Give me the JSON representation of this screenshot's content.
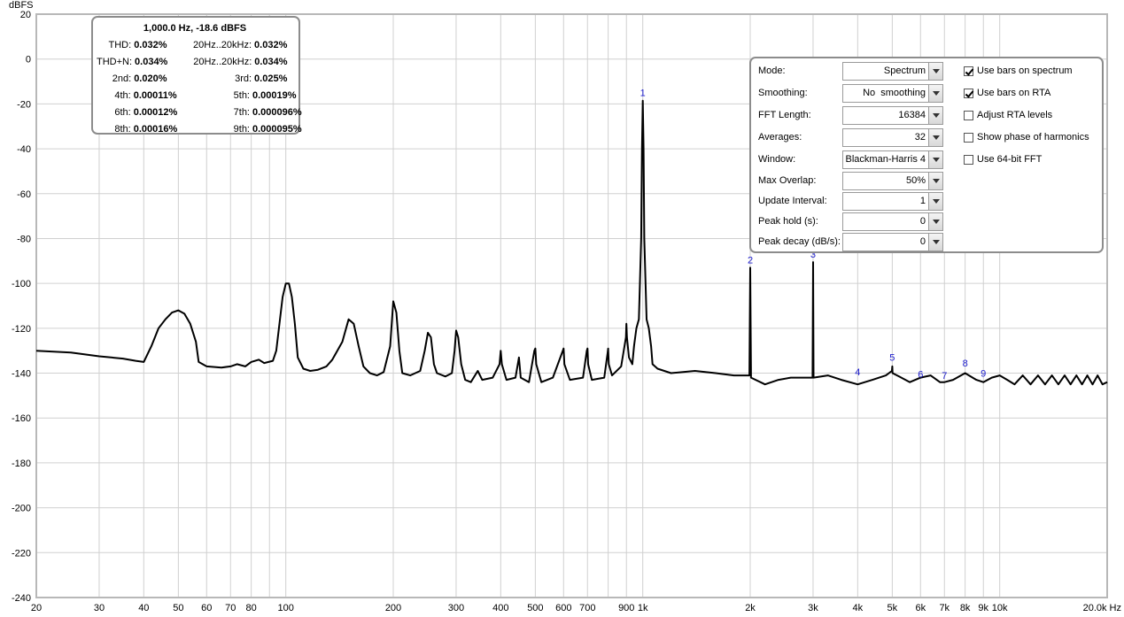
{
  "chart_data": {
    "type": "line",
    "title": "",
    "xlabel": "Hz",
    "ylabel": "dBFS",
    "x_scale": "log",
    "xlim": [
      20,
      20000
    ],
    "ylim": [
      -240,
      20
    ],
    "grid": true,
    "y_ticks": [
      20,
      0,
      -20,
      -40,
      -60,
      -80,
      -100,
      -120,
      -140,
      -160,
      -180,
      -200,
      -220,
      -240
    ],
    "x_ticks": [
      {
        "value": 20,
        "label": "20"
      },
      {
        "value": 30,
        "label": "30"
      },
      {
        "value": 40,
        "label": "40"
      },
      {
        "value": 50,
        "label": "50"
      },
      {
        "value": 60,
        "label": "60"
      },
      {
        "value": 70,
        "label": "70"
      },
      {
        "value": 80,
        "label": "80"
      },
      {
        "value": 100,
        "label": "100"
      },
      {
        "value": 200,
        "label": "200"
      },
      {
        "value": 300,
        "label": "300"
      },
      {
        "value": 400,
        "label": "400"
      },
      {
        "value": 500,
        "label": "500"
      },
      {
        "value": 600,
        "label": "600"
      },
      {
        "value": 700,
        "label": "700"
      },
      {
        "value": 900,
        "label": "900"
      },
      {
        "value": 1000,
        "label": "1k"
      },
      {
        "value": 2000,
        "label": "2k"
      },
      {
        "value": 3000,
        "label": "3k"
      },
      {
        "value": 4000,
        "label": "4k"
      },
      {
        "value": 5000,
        "label": "5k"
      },
      {
        "value": 6000,
        "label": "6k"
      },
      {
        "value": 7000,
        "label": "7k"
      },
      {
        "value": 8000,
        "label": "8k"
      },
      {
        "value": 9000,
        "label": "9k"
      },
      {
        "value": 10000,
        "label": "10k"
      },
      {
        "value": 20000,
        "label": "20.0k Hz"
      }
    ],
    "minor_x_gridlines": [
      90,
      800
    ],
    "series": [
      {
        "color": "#000000",
        "points": [
          [
            20,
            -130
          ],
          [
            25,
            -130.8
          ],
          [
            30,
            -132.5
          ],
          [
            35,
            -133.5
          ],
          [
            38,
            -134.5
          ],
          [
            40,
            -135
          ],
          [
            42,
            -128
          ],
          [
            44,
            -120
          ],
          [
            46,
            -116
          ],
          [
            48,
            -113
          ],
          [
            50,
            -112
          ],
          [
            52,
            -113.5
          ],
          [
            54,
            -118
          ],
          [
            56,
            -126
          ],
          [
            57,
            -135
          ],
          [
            60,
            -137
          ],
          [
            66,
            -137.5
          ],
          [
            70,
            -137
          ],
          [
            73,
            -136
          ],
          [
            77,
            -137
          ],
          [
            80,
            -135
          ],
          [
            84,
            -134
          ],
          [
            87,
            -135.5
          ],
          [
            92,
            -134.5
          ],
          [
            94,
            -130
          ],
          [
            96,
            -118
          ],
          [
            98,
            -106
          ],
          [
            100,
            -100
          ],
          [
            102,
            -100
          ],
          [
            104,
            -106
          ],
          [
            106,
            -118
          ],
          [
            108,
            -133
          ],
          [
            112,
            -138
          ],
          [
            117,
            -139
          ],
          [
            123,
            -138.5
          ],
          [
            130,
            -137
          ],
          [
            135,
            -134
          ],
          [
            144,
            -126
          ],
          [
            150,
            -116
          ],
          [
            155,
            -118
          ],
          [
            160,
            -128
          ],
          [
            165,
            -137
          ],
          [
            172,
            -140
          ],
          [
            180,
            -141
          ],
          [
            188,
            -139.5
          ],
          [
            196,
            -128
          ],
          [
            200,
            -108
          ],
          [
            204,
            -113
          ],
          [
            208,
            -130
          ],
          [
            212,
            -140
          ],
          [
            223,
            -141
          ],
          [
            238,
            -139
          ],
          [
            245,
            -130
          ],
          [
            250,
            -122
          ],
          [
            255,
            -124
          ],
          [
            260,
            -136
          ],
          [
            265,
            -140
          ],
          [
            280,
            -141.5
          ],
          [
            292,
            -140
          ],
          [
            297,
            -130
          ],
          [
            300,
            -121
          ],
          [
            304,
            -124
          ],
          [
            310,
            -136
          ],
          [
            318,
            -143
          ],
          [
            330,
            -144
          ],
          [
            345,
            -139
          ],
          [
            355,
            -143
          ],
          [
            380,
            -142
          ],
          [
            397,
            -136
          ],
          [
            400,
            -130
          ],
          [
            403,
            -136
          ],
          [
            415,
            -143
          ],
          [
            440,
            -142
          ],
          [
            450,
            -133
          ],
          [
            455,
            -142
          ],
          [
            480,
            -144
          ],
          [
            497,
            -130
          ],
          [
            500,
            -129
          ],
          [
            503,
            -136
          ],
          [
            520,
            -144
          ],
          [
            560,
            -142
          ],
          [
            597,
            -130
          ],
          [
            600,
            -129
          ],
          [
            603,
            -136
          ],
          [
            625,
            -143
          ],
          [
            680,
            -142
          ],
          [
            697,
            -130
          ],
          [
            700,
            -129
          ],
          [
            703,
            -136
          ],
          [
            720,
            -143
          ],
          [
            780,
            -142
          ],
          [
            797,
            -131
          ],
          [
            800,
            -129
          ],
          [
            803,
            -136
          ],
          [
            820,
            -141
          ],
          [
            870,
            -137
          ],
          [
            897,
            -124
          ],
          [
            900,
            -118
          ],
          [
            903,
            -124
          ],
          [
            915,
            -133
          ],
          [
            935,
            -136
          ],
          [
            945,
            -128
          ],
          [
            960,
            -120
          ],
          [
            975,
            -116
          ],
          [
            990,
            -80
          ],
          [
            995,
            -40
          ],
          [
            1000,
            -18.6
          ],
          [
            1005,
            -40
          ],
          [
            1010,
            -80
          ],
          [
            1025,
            -116
          ],
          [
            1040,
            -120
          ],
          [
            1055,
            -128
          ],
          [
            1065,
            -136
          ],
          [
            1100,
            -138
          ],
          [
            1200,
            -140
          ],
          [
            1400,
            -139
          ],
          [
            1600,
            -140
          ],
          [
            1800,
            -141
          ],
          [
            1990,
            -141
          ],
          [
            2000,
            -93
          ],
          [
            2010,
            -142
          ],
          [
            2200,
            -145
          ],
          [
            2400,
            -143
          ],
          [
            2600,
            -142
          ],
          [
            2990,
            -142
          ],
          [
            3000,
            -90.5
          ],
          [
            3010,
            -142
          ],
          [
            3300,
            -141
          ],
          [
            3600,
            -143
          ],
          [
            4000,
            -145
          ],
          [
            4400,
            -143
          ],
          [
            4800,
            -141
          ],
          [
            4990,
            -139
          ],
          [
            5000,
            -137
          ],
          [
            5010,
            -140
          ],
          [
            5300,
            -142
          ],
          [
            5600,
            -144
          ],
          [
            6000,
            -142
          ],
          [
            6400,
            -141
          ],
          [
            6800,
            -144
          ],
          [
            7000,
            -144
          ],
          [
            7400,
            -143
          ],
          [
            8000,
            -140
          ],
          [
            8600,
            -143
          ],
          [
            9000,
            -144
          ],
          [
            9500,
            -142
          ],
          [
            10000,
            -141
          ],
          [
            10500,
            -143
          ],
          [
            11000,
            -145
          ],
          [
            11600,
            -141
          ],
          [
            12200,
            -145
          ],
          [
            12800,
            -141
          ],
          [
            13400,
            -145
          ],
          [
            14000,
            -141
          ],
          [
            14600,
            -145
          ],
          [
            15200,
            -141
          ],
          [
            15800,
            -145
          ],
          [
            16400,
            -141
          ],
          [
            17000,
            -145
          ],
          [
            17600,
            -141
          ],
          [
            18200,
            -145
          ],
          [
            18800,
            -141
          ],
          [
            19400,
            -145
          ],
          [
            20000,
            -144
          ]
        ]
      }
    ],
    "harmonic_markers": [
      {
        "label": "1",
        "freq": 1000,
        "db": -16.5
      },
      {
        "label": "2",
        "freq": 2000,
        "db": -91
      },
      {
        "label": "3",
        "freq": 3000,
        "db": -88.5
      },
      {
        "label": "4",
        "freq": 4000,
        "db": -141
      },
      {
        "label": "5",
        "freq": 5000,
        "db": -134.5
      },
      {
        "label": "6",
        "freq": 6000,
        "db": -142
      },
      {
        "label": "7",
        "freq": 7000,
        "db": -142.5
      },
      {
        "label": "8",
        "freq": 8000,
        "db": -137
      },
      {
        "label": "9",
        "freq": 9000,
        "db": -141.5
      }
    ]
  },
  "distortion": {
    "header": "1,000.0 Hz, -18.6 dBFS",
    "rows": [
      {
        "l1": "THD:",
        "v1": "0.032%",
        "l2": "20Hz..20kHz:",
        "v2": "0.032%"
      },
      {
        "l1": "THD+N:",
        "v1": "0.034%",
        "l2": "20Hz..20kHz:",
        "v2": "0.034%"
      },
      {
        "l1": "2nd:",
        "v1": "0.020%",
        "l2": "3rd:",
        "v2": "0.025%"
      },
      {
        "l1": "4th:",
        "v1": "0.00011%",
        "l2": "5th:",
        "v2": "0.00019%"
      },
      {
        "l1": "6th:",
        "v1": "0.00012%",
        "l2": "7th:",
        "v2": "0.000096%"
      },
      {
        "l1": "8th:",
        "v1": "0.00016%",
        "l2": "9th:",
        "v2": "0.000095%"
      }
    ]
  },
  "settings": {
    "mode": {
      "label": "Mode:",
      "value": "Spectrum"
    },
    "smoothing": {
      "label": "Smoothing:",
      "value": "No  smoothing"
    },
    "fft_length": {
      "label": "FFT Length:",
      "value": "16384"
    },
    "averages": {
      "label": "Averages:",
      "value": "32"
    },
    "window": {
      "label": "Window:",
      "value": "Blackman-Harris 4"
    },
    "max_overlap": {
      "label": "Max Overlap:",
      "value": "50%"
    },
    "update_interval": {
      "label": "Update Interval:",
      "value": "1"
    },
    "peak_hold": {
      "label": "Peak hold (s):",
      "value": "0"
    },
    "peak_decay": {
      "label": "Peak decay (dB/s):",
      "value": "0"
    }
  },
  "options": {
    "bars_spectrum": {
      "label": "Use bars on spectrum",
      "checked": true
    },
    "bars_rta": {
      "label": "Use bars on RTA",
      "checked": true
    },
    "adjust_rta": {
      "label": "Adjust RTA levels",
      "checked": false
    },
    "show_phase": {
      "label": "Show phase of harmonics",
      "checked": false
    },
    "fft64": {
      "label": "Use 64-bit FFT",
      "checked": false
    }
  }
}
